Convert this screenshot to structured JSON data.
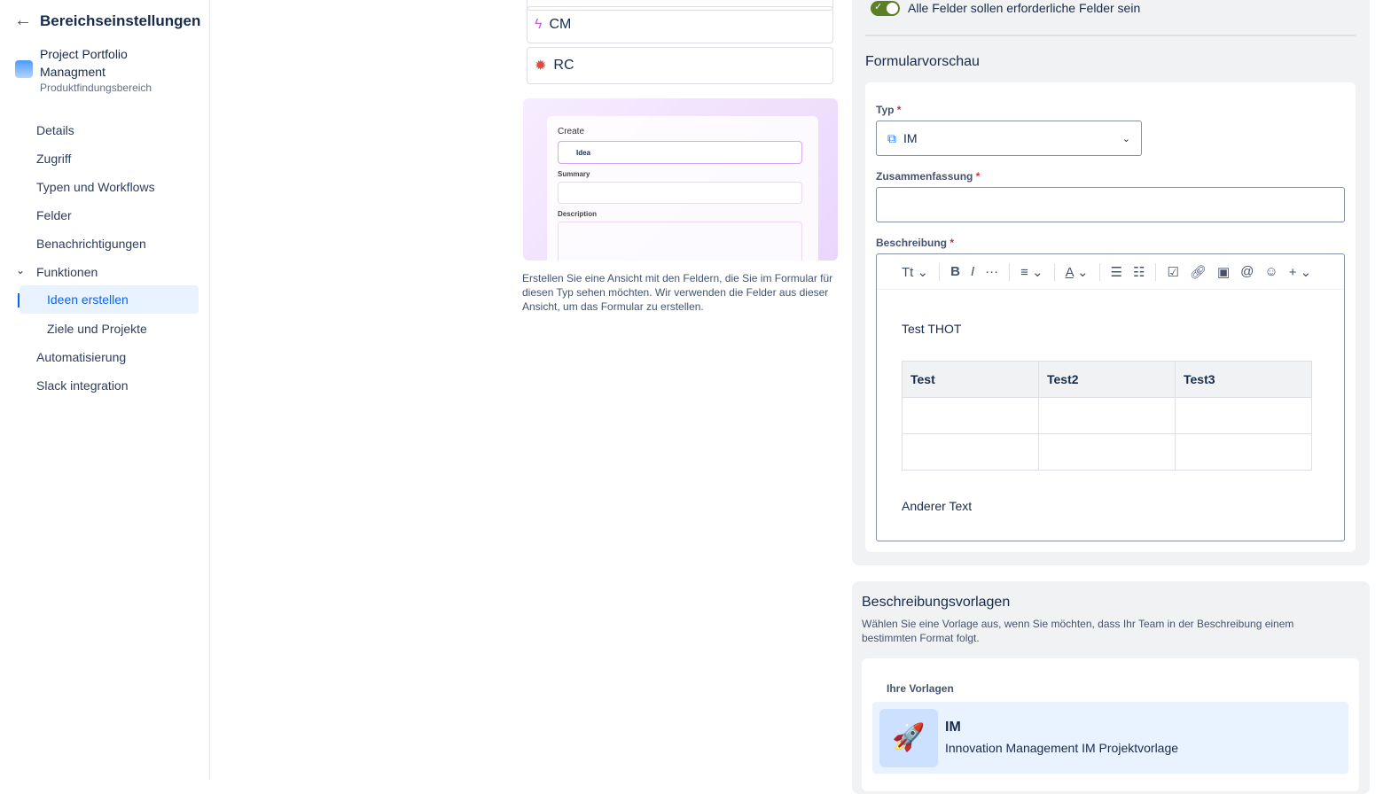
{
  "sidebar": {
    "title": "Bereichseinstellungen",
    "project_name_1": "Project Portfolio",
    "project_name_2": "Managment",
    "project_type": "Produktfindungsbereich",
    "items": [
      "Details",
      "Zugriff",
      "Typen und Workflows",
      "Felder",
      "Benachrichtigungen",
      "Funktionen",
      "Ideen erstellen",
      "Ziele und Projekte",
      "Automatisierung",
      "Slack integration"
    ]
  },
  "types": [
    {
      "label": "CM",
      "icon": "lightning-icon"
    },
    {
      "label": "RC",
      "icon": "bug-icon"
    }
  ],
  "illustration": {
    "create": "Create",
    "idea": "Idea",
    "summary": "Summary",
    "description": "Description"
  },
  "help_text": "Erstellen Sie eine Ansicht mit den Feldern, die Sie im Formular für diesen Typ sehen möchten. Wir verwenden die Felder aus dieser Ansicht, um das Formular zu erstellen.",
  "toggle": {
    "label": "Alle Felder sollen erforderliche Felder sein",
    "on": true,
    "color": "#5b7f24"
  },
  "preview": {
    "title": "Formularvorschau",
    "typ_label": "Typ",
    "typ_value": "IM",
    "summary_label": "Zusammenfassung",
    "desc_label": "Beschreibung",
    "required": "*",
    "toolbar": {
      "text_style": "Tt",
      "bold": "B",
      "italic": "I",
      "more": "···",
      "color": "A",
      "add": "+"
    },
    "content_text": "Test THOT",
    "table_headers": [
      "Test",
      "Test2",
      "Test3"
    ],
    "after_text": "Anderer Text"
  },
  "templates": {
    "title": "Beschreibungsvorlagen",
    "desc": "Wählen Sie eine Vorlage aus, wenn Sie möchten, dass Ihr Team in der Beschreibung einem bestimmten Format folgt.",
    "section": "Ihre Vorlagen",
    "item_title": "IM",
    "item_desc": "Innovation Management IM Projektvorlage"
  }
}
